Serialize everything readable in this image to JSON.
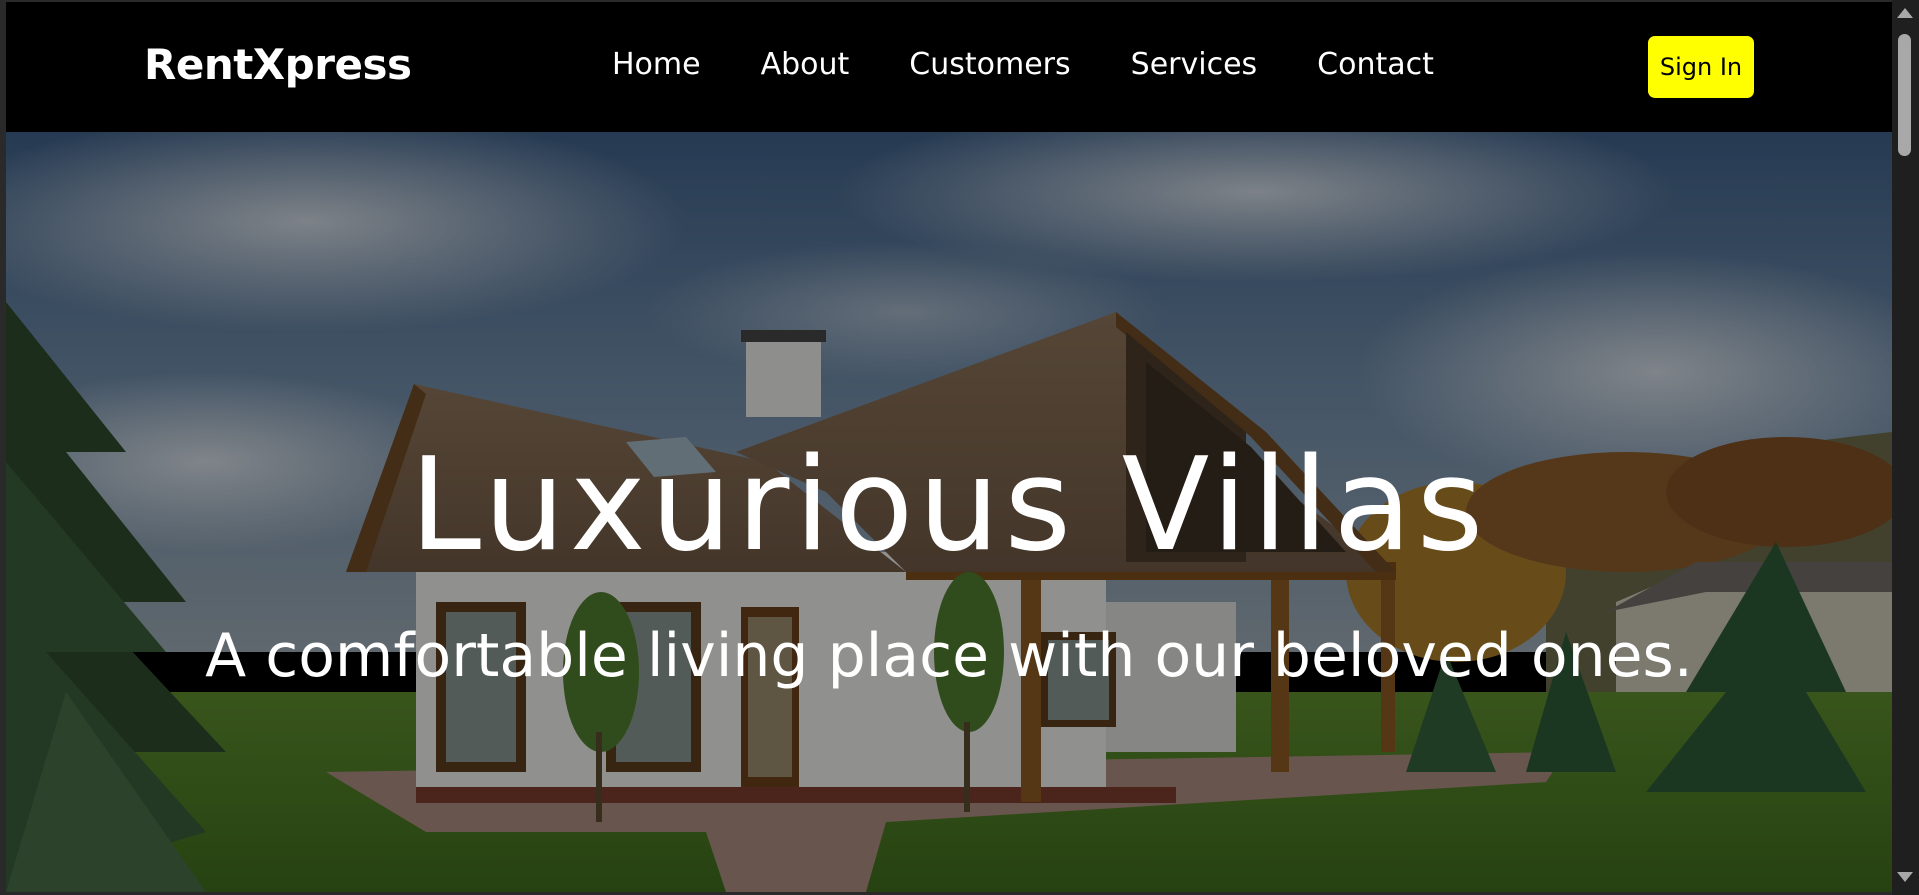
{
  "navbar": {
    "brand": "RentXpress",
    "links": [
      "Home",
      "About",
      "Customers",
      "Services",
      "Contact"
    ],
    "signin_label": "Sign In"
  },
  "hero": {
    "title": "Luxurious Villas",
    "subtitle": "A comfortable living place with our beloved ones.",
    "image": "villa-house-photo"
  },
  "colors": {
    "navbar_bg": "#000000",
    "signin_bg": "#ffff00",
    "text": "#ffffff"
  }
}
